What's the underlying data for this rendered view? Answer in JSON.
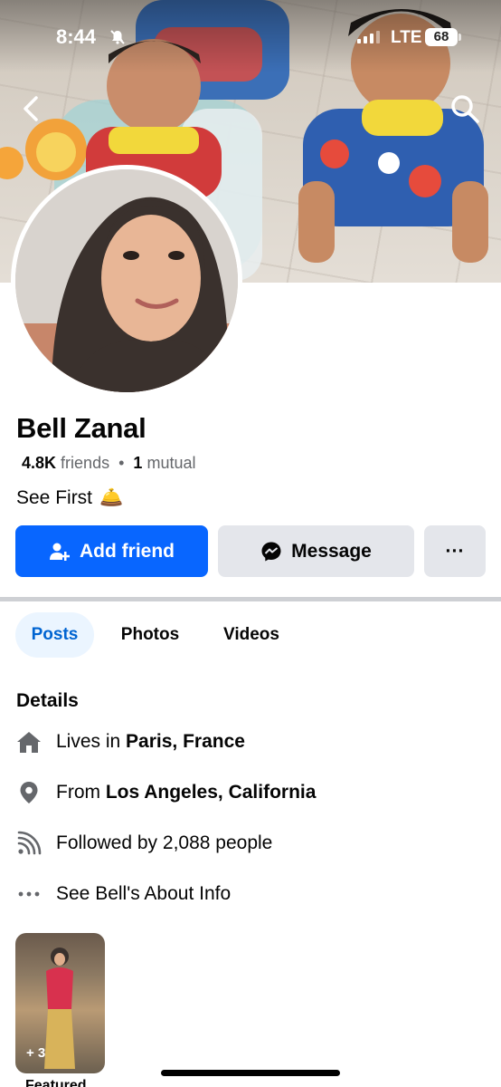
{
  "status_bar": {
    "time": "8:44",
    "network": "LTE",
    "battery": "68"
  },
  "profile": {
    "name": "Bell Zanal",
    "friends_count": "4.8K",
    "friends_label": "friends",
    "separator": "•",
    "mutual_count": "1",
    "mutual_label": "mutual",
    "see_first": "See First",
    "see_first_emoji": "🛎️"
  },
  "actions": {
    "add_friend": "Add friend",
    "message": "Message",
    "more": "···"
  },
  "tabs": [
    {
      "label": "Posts",
      "active": true
    },
    {
      "label": "Photos",
      "active": false
    },
    {
      "label": "Videos",
      "active": false
    }
  ],
  "details": {
    "heading": "Details",
    "lives_prefix": "Lives in ",
    "lives_value": "Paris, France",
    "from_prefix": "From ",
    "from_value": "Los Angeles, California",
    "followed_by": "Followed by 2,088 people",
    "about_link": "See Bell's About Info"
  },
  "featured": {
    "count": "+ 3",
    "label": "Featured"
  },
  "colors": {
    "primary": "#0866ff",
    "tab_active_bg": "#ebf5ff",
    "tab_active_text": "#0064d1",
    "button_gray": "#e4e6eb"
  },
  "icons": [
    "back-arrow-icon",
    "search-icon",
    "bell-off-icon",
    "add-person-icon",
    "messenger-icon",
    "home-icon",
    "location-pin-icon",
    "rss-icon",
    "ellipsis-icon"
  ]
}
